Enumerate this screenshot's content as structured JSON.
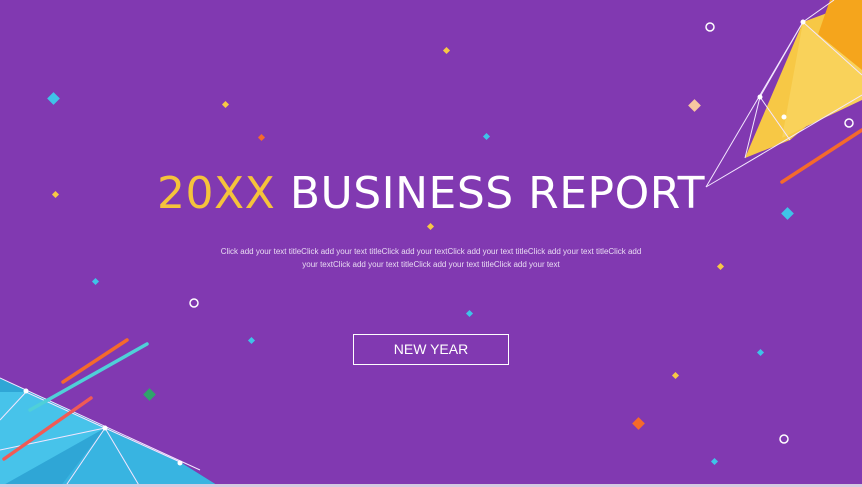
{
  "slide": {
    "title_accent": "20XX",
    "title_main": "BUSINESS REPORT",
    "subtitle_line1": "Click add your text titleClick add your text titleClick add your textClick add your text titleClick add your text titleClick add",
    "subtitle_line2": "your textClick add your text titleClick add your text titleClick add your text",
    "button_label": "NEW YEAR"
  },
  "colors": {
    "background": "#8139b1",
    "accent_yellow": "#f5c33b",
    "orange": "#f58a1f",
    "cyan": "#3fc3e8",
    "coral": "#f05a55"
  }
}
